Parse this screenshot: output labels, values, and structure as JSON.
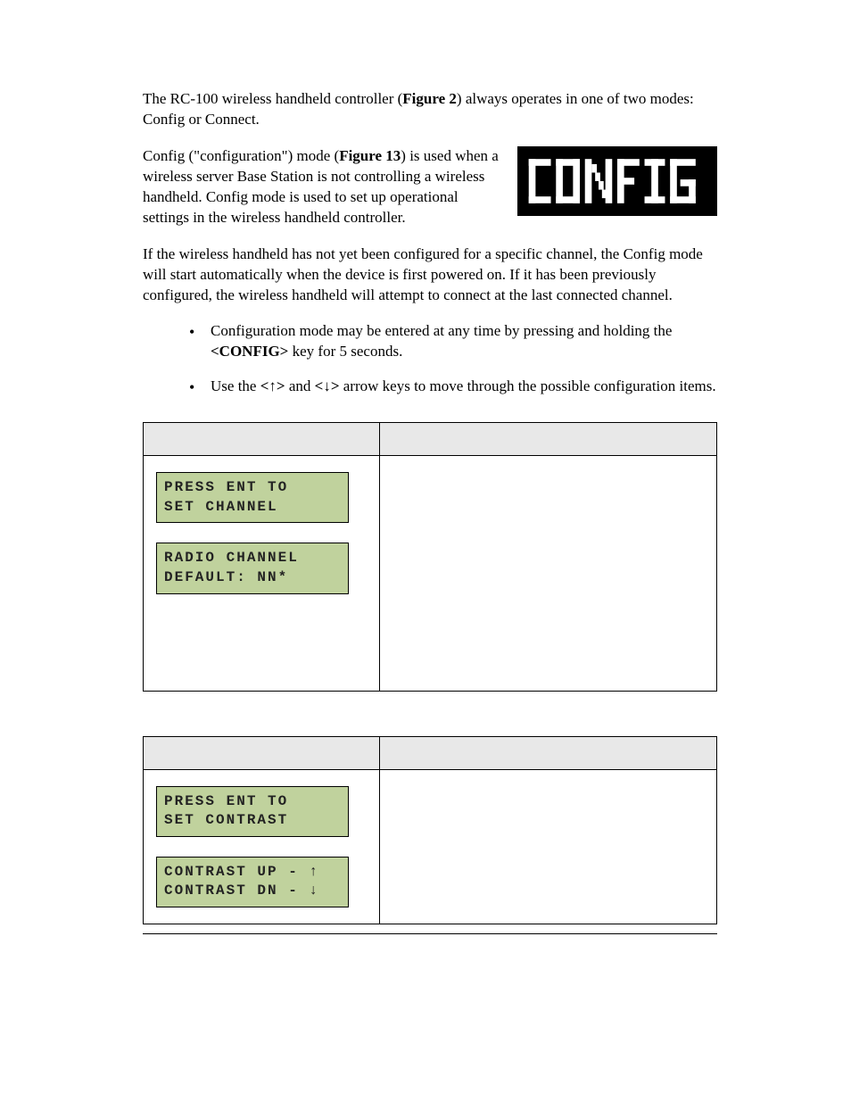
{
  "intro": {
    "p1_a": "The RC-100 wireless handheld controller (",
    "p1_fig": "Figure 2",
    "p1_b": ") always operates in one of two modes: Config or Connect."
  },
  "config_section": {
    "badge_label": "CONFIG",
    "p2_a": "Config (\"configuration\") mode (",
    "p2_fig": "Figure 13",
    "p2_b": ") is used when a wireless server Base Station is not controlling a wireless handheld. Config mode is used to set up operational settings in the wireless handheld controller.",
    "p3": "If the wireless handheld has not yet been configured for a specific channel, the Config mode will start automatically when the device is first powered on. If it has been previously configured, the wireless handheld will attempt to connect at the last connected channel."
  },
  "bullets": {
    "b1_a": "Configuration mode may be entered at any time by pressing and holding the ",
    "b1_key": "<CONFIG>",
    "b1_b": " key for 5 seconds.",
    "b2_a": "Use the ",
    "b2_key1": "<↑>",
    "b2_mid": " and ",
    "b2_key2": "<↓>",
    "b2_b": " arrow keys to move through the possible configuration items."
  },
  "table1": {
    "header_left": "",
    "header_right": "",
    "lcd1": "PRESS ENT TO\nSET CHANNEL",
    "lcd2": "RADIO CHANNEL\nDEFAULT: NN*",
    "desc": ""
  },
  "table2": {
    "header_left": "",
    "header_right": "",
    "lcd1": "PRESS ENT TO\nSET CONTRAST",
    "lcd2": "CONTRAST UP - ↑\nCONTRAST DN - ↓",
    "desc": ""
  }
}
